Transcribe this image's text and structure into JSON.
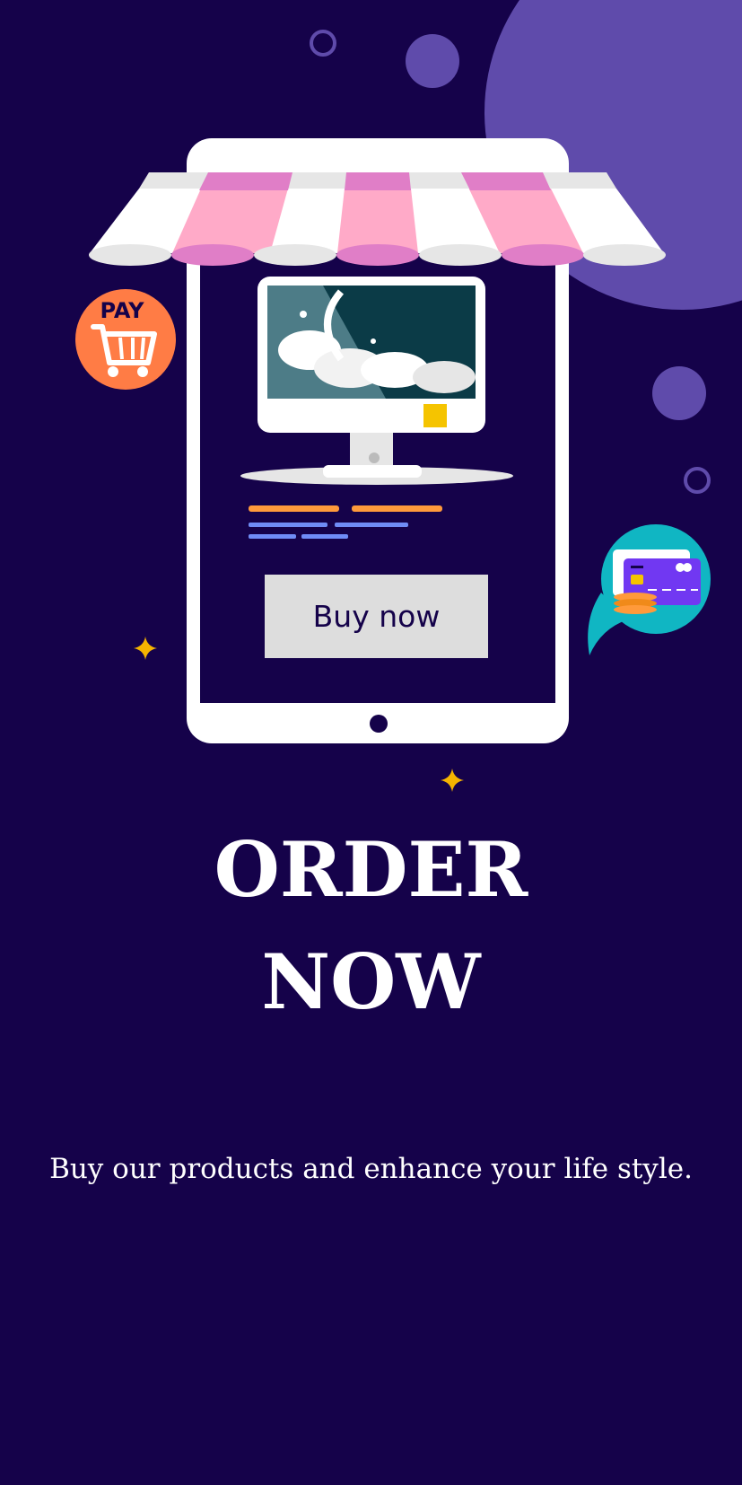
{
  "hero": {
    "pay_badge_text": "PAY",
    "buy_button_label": "Buy now"
  },
  "headline": {
    "line1": "ORDER",
    "line2": "NOW"
  },
  "subtitle": "Buy our products and enhance your life style.",
  "colors": {
    "background": "#15024a",
    "accent_purple": "#5f4bab",
    "awning_pink": "#ffaac8",
    "awning_pink_dark": "#e07ec7",
    "pay_orange": "#ff7c45",
    "sparkle_yellow": "#f5b400",
    "chat_teal": "#10b6c3",
    "card_purple": "#7138f2"
  },
  "icons": [
    "shop-awning-icon",
    "pay-cart-icon",
    "credit-card-icon",
    "sparkle-icon",
    "monitor-icon"
  ]
}
